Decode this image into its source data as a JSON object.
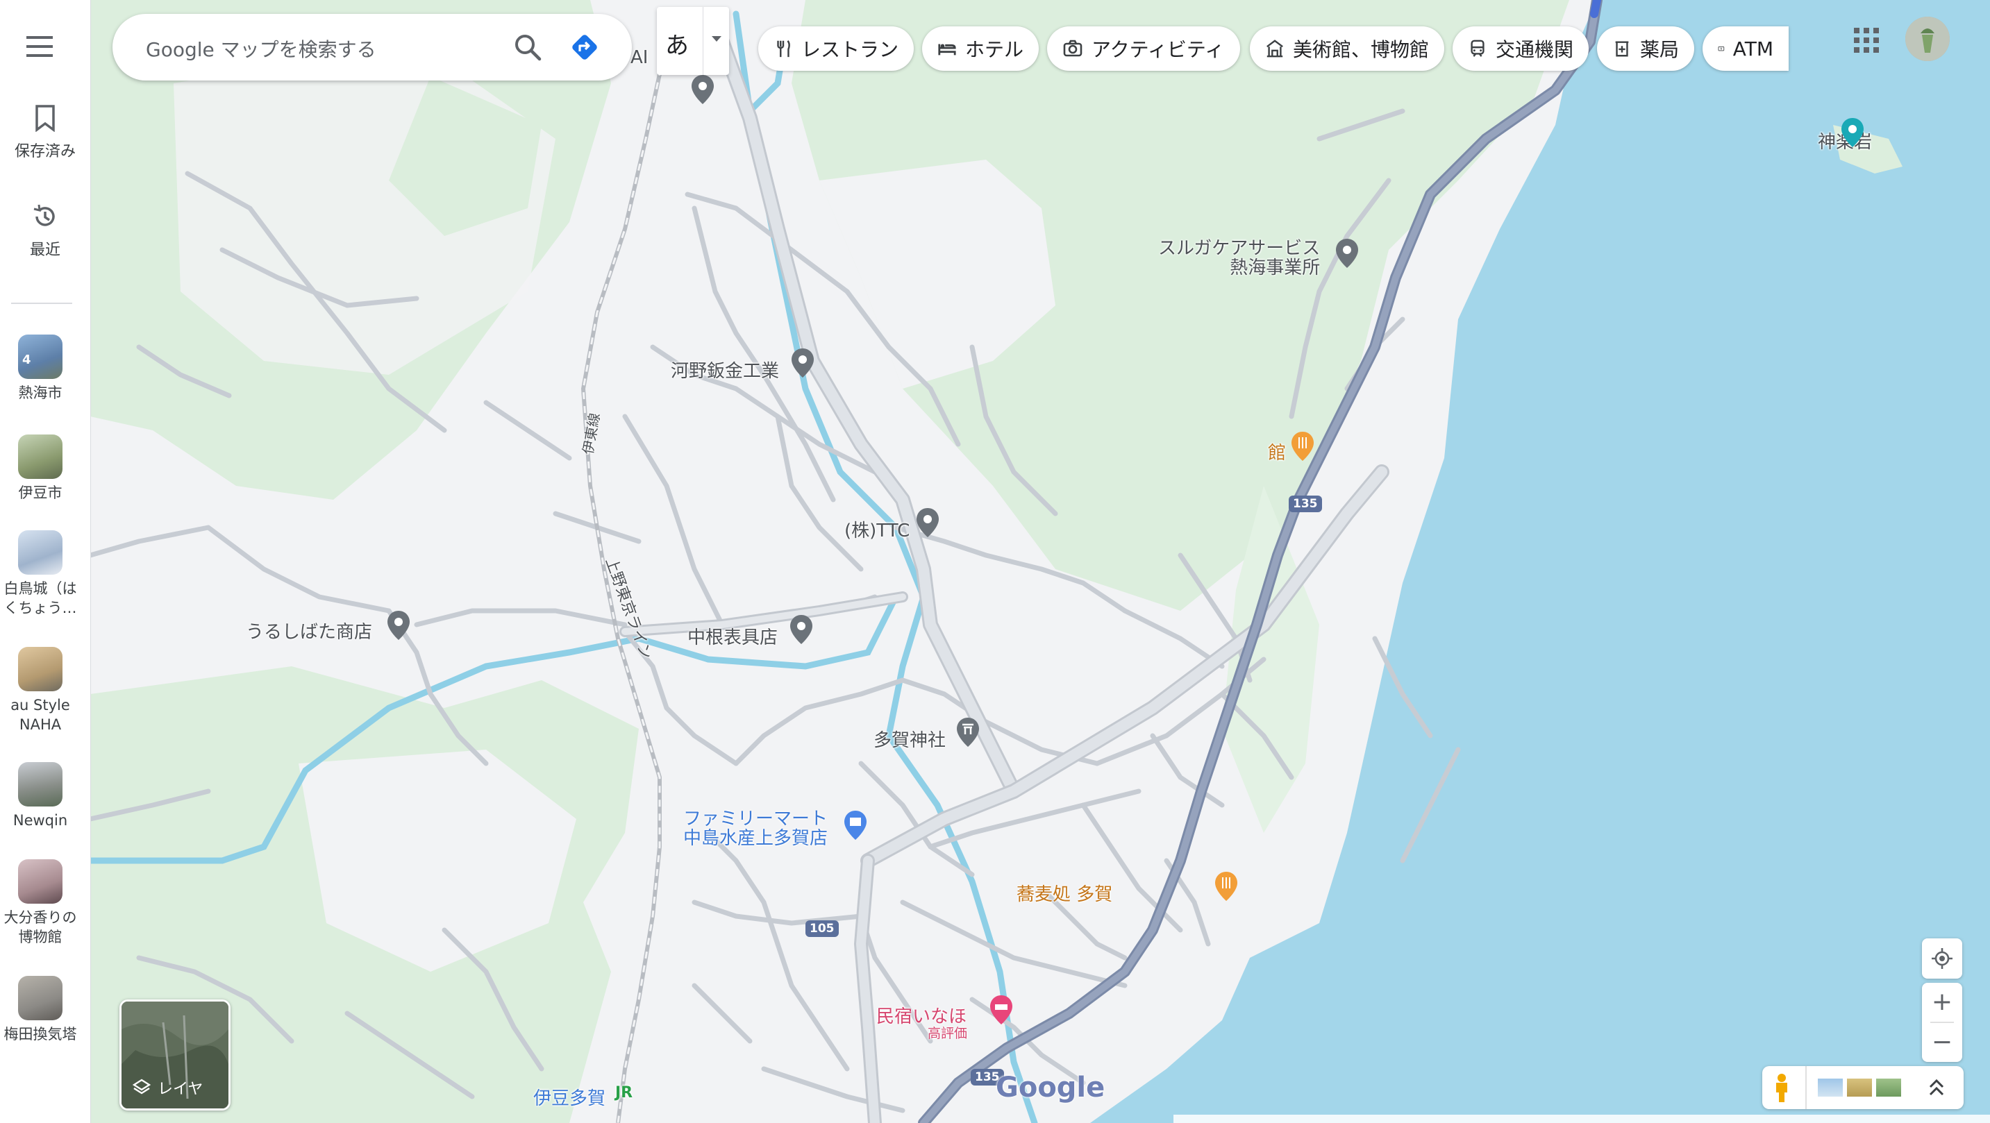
{
  "sidebar": {
    "menu_icon": "hamburger-icon",
    "saved": {
      "label": "保存済み",
      "icon": "bookmark-icon"
    },
    "recent": {
      "label": "最近",
      "icon": "history-icon"
    },
    "recents": [
      {
        "label": "熱海市",
        "badge": "4",
        "color": "#5d7fa8"
      },
      {
        "label": "伊豆市",
        "color": "#8a9a6e"
      },
      {
        "label": "白鳥城（はくちょう…",
        "color": "#9fb3cc"
      },
      {
        "label": "au Style NAHA",
        "color": "#b49a70"
      },
      {
        "label": "Newqin",
        "color": "#8a8f8a"
      },
      {
        "label": "大分香りの博物館",
        "color": "#a68a8f"
      },
      {
        "label": "梅田換気塔",
        "color": "#8c8a86"
      }
    ]
  },
  "search": {
    "placeholder": "Google マップを検索する",
    "icon": "search-icon",
    "directions_icon": "directions-icon"
  },
  "ime": {
    "char": "あ",
    "icon": "dropdown-arrow-icon"
  },
  "chips": [
    {
      "label": "レストラン",
      "icon": "restaurant-icon"
    },
    {
      "label": "ホテル",
      "icon": "hotel-icon"
    },
    {
      "label": "アクティビティ",
      "icon": "camera-icon"
    },
    {
      "label": "美術館、博物館",
      "icon": "museum-icon"
    },
    {
      "label": "交通機関",
      "icon": "train-icon"
    },
    {
      "label": "薬局",
      "icon": "pharmacy-icon"
    },
    {
      "label": "ATM",
      "icon": "atm-icon"
    }
  ],
  "map": {
    "places": [
      {
        "label": "神楽岩",
        "type": "attraction"
      },
      {
        "label": "スルガケアサービス\n熱海事業所",
        "type": "place"
      },
      {
        "label": "河野鈑金工業",
        "type": "place"
      },
      {
        "label": "館",
        "type": "restaurant"
      },
      {
        "label": "(株)TTC",
        "type": "place"
      },
      {
        "label": "うるしばた商店",
        "type": "place"
      },
      {
        "label": "中根表具店",
        "type": "place"
      },
      {
        "label": "多賀神社",
        "type": "shrine"
      },
      {
        "label": "ファミリーマート\n中島水産上多賀店",
        "type": "store"
      },
      {
        "label": "蕎麦処 多賀",
        "type": "restaurant"
      },
      {
        "label": "民宿いなほ",
        "type": "hotel",
        "sub": "高評価"
      },
      {
        "label": "伊豆多賀",
        "type": "station",
        "line_badge": "JR"
      },
      {
        "label": "AI",
        "type": "place"
      }
    ],
    "road_labels": {
      "rail_1": "伊東線",
      "rail_2": "上野東京ライン"
    },
    "route_shields": [
      "135",
      "135",
      "105",
      "135"
    ],
    "google_logo": "Google",
    "colors": {
      "water": "#a8d8ea",
      "park": "#d9f0dd",
      "land": "#f2f3f5",
      "highway": "#8e9db8",
      "river": "#8ecfe6"
    }
  },
  "controls": {
    "layers_label": "レイヤ",
    "layers_icon": "layers-icon",
    "locate_icon": "my-location-icon",
    "zoom_in": "+",
    "zoom_out": "−",
    "pegman_icon": "pegman-icon",
    "expand_icon": "chevron-up-icon",
    "apps_icon": "apps-grid-icon"
  }
}
